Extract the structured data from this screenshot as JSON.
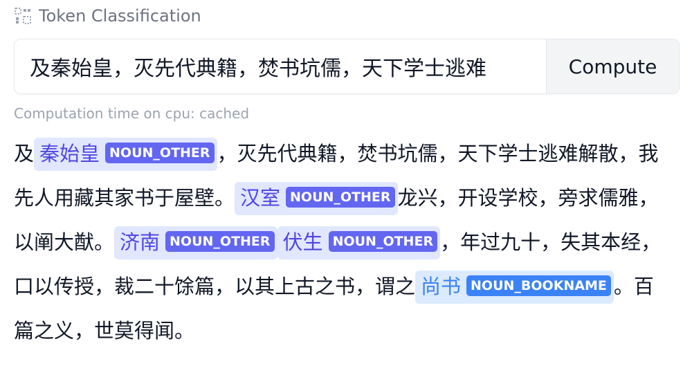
{
  "widget": {
    "title": "Token Classification",
    "icon": "token-grid-icon"
  },
  "input": {
    "value": "及秦始皇，灭先代典籍，焚书坑儒，天下学士逃难",
    "compute_label": "Compute"
  },
  "status": {
    "timing": "Computation time on cpu: cached"
  },
  "output": {
    "segments": [
      {
        "text": "及"
      },
      {
        "entity": "秦始皇",
        "label": "NOUN_OTHER"
      },
      {
        "text": "，灭先代典籍，焚书坑儒，天下学士逃难解散，我先人用藏其家书于屋壁。"
      },
      {
        "entity": "汉室",
        "label": "NOUN_OTHER"
      },
      {
        "text": "龙兴，开设学校，旁求儒雅，以阐大猷。"
      },
      {
        "entity": "济南",
        "label": "NOUN_OTHER"
      },
      {
        "entity": "伏生",
        "label": "NOUN_OTHER"
      },
      {
        "text": "，年过九十，失其本经，口以传授，裁二十馀篇，以其上古之书，谓之"
      },
      {
        "entity": "尚书",
        "label": "NOUN_BOOKNAME"
      },
      {
        "text": "。百篇之义，世莫得闻。"
      }
    ]
  },
  "colors": {
    "noun_other_bg": "#e0e7ff",
    "noun_other_tag": "#6366f1",
    "noun_bookname_bg": "#dbeafe",
    "noun_bookname_tag": "#3b82f6"
  }
}
